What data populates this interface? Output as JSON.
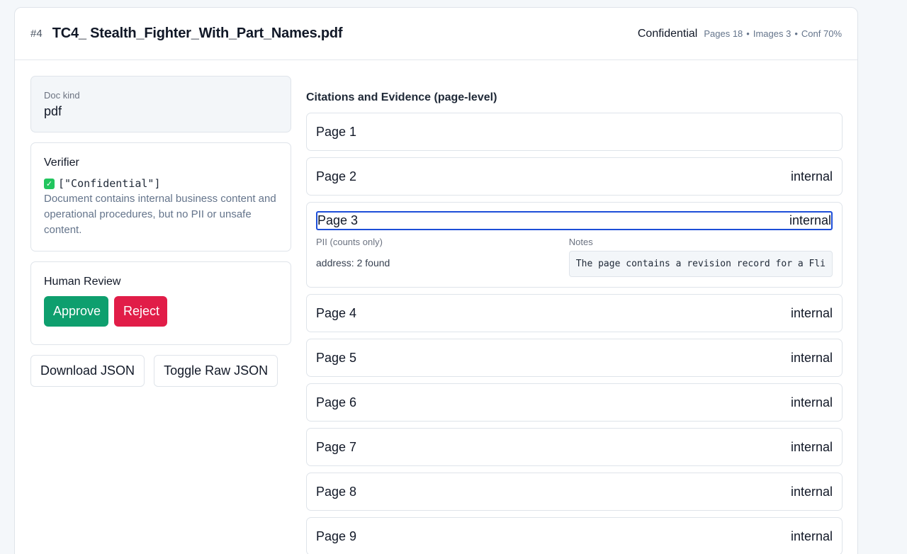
{
  "header": {
    "number": "#4",
    "title": "TC4_ Stealth_Fighter_With_Part_Names.pdf",
    "classification": "Confidential",
    "pages": "Pages 18",
    "images": "Images 3",
    "conf": "Conf 70%",
    "sep": "•"
  },
  "doc_kind": {
    "label": "Doc kind",
    "value": "pdf"
  },
  "verifier": {
    "title": "Verifier",
    "check_icon": "check-mark-icon",
    "labels": "[\"Confidential\"]",
    "description": "Document contains internal business content and operational procedures, but no PII or unsafe content."
  },
  "human_review": {
    "title": "Human Review",
    "approve": "Approve",
    "reject": "Reject"
  },
  "actions": {
    "download": "Download JSON",
    "toggle": "Toggle Raw JSON"
  },
  "citations": {
    "title": "Citations and Evidence (page-level)",
    "pages": [
      {
        "name": "Page 1",
        "tag": ""
      },
      {
        "name": "Page 2",
        "tag": "internal"
      },
      {
        "name": "Page 3",
        "tag": "internal"
      },
      {
        "name": "Page 4",
        "tag": "internal"
      },
      {
        "name": "Page 5",
        "tag": "internal"
      },
      {
        "name": "Page 6",
        "tag": "internal"
      },
      {
        "name": "Page 7",
        "tag": "internal"
      },
      {
        "name": "Page 8",
        "tag": "internal"
      },
      {
        "name": "Page 9",
        "tag": "internal"
      }
    ],
    "expanded": {
      "pii_label": "PII (counts only)",
      "pii_key": "address:",
      "pii_value": "2 found",
      "notes_label": "Notes",
      "notes_text": "The page contains a revision record for a Fli"
    }
  },
  "colors": {
    "approve": "#0e9f6e",
    "reject": "#e11d48",
    "focus": "#1d4ed8"
  }
}
